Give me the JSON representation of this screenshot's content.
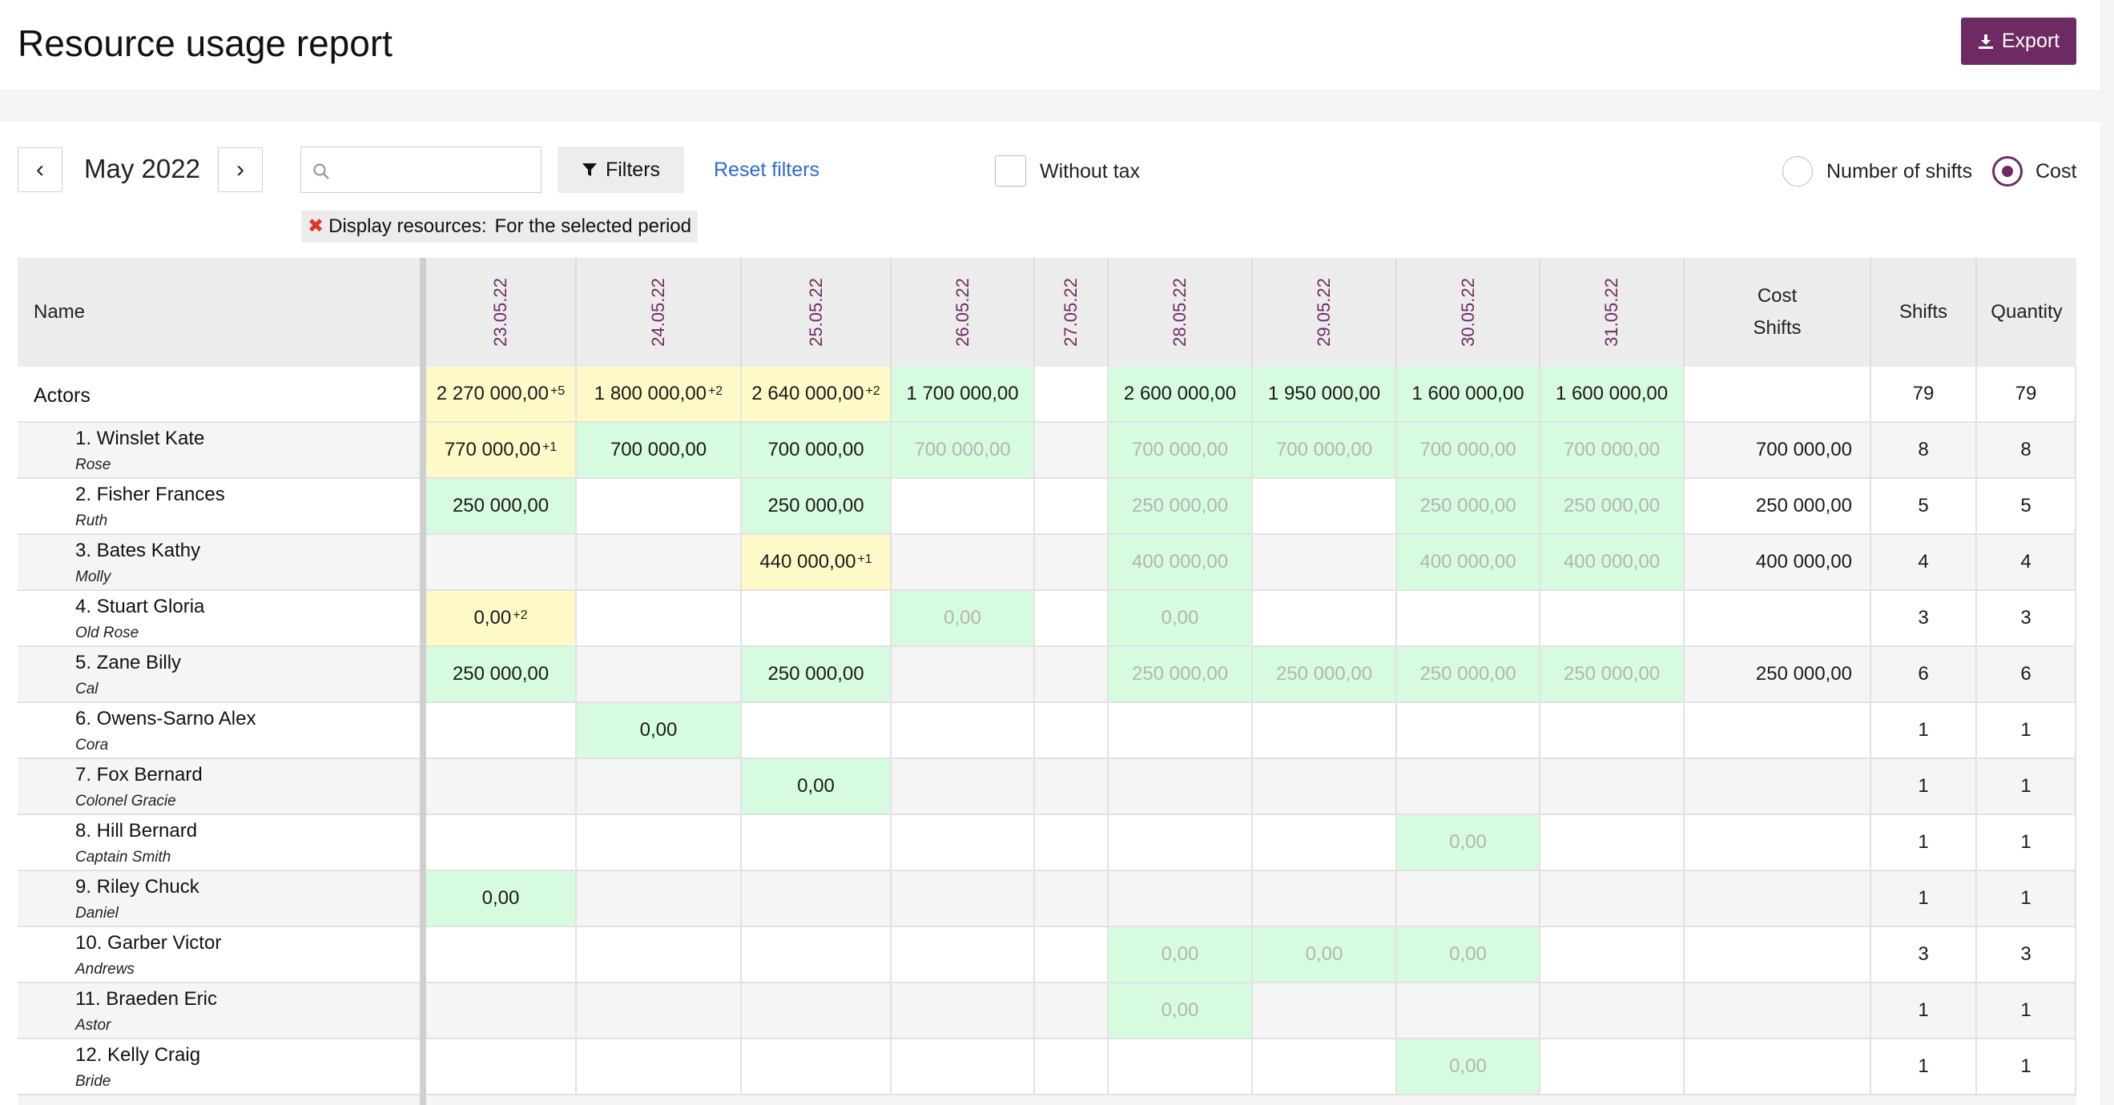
{
  "header": {
    "title": "Resource usage report",
    "export_label": "Export"
  },
  "toolbar": {
    "prev": "‹",
    "next": "›",
    "month": "May 2022",
    "search_placeholder": "",
    "filters_label": "Filters",
    "reset_label": "Reset filters",
    "chip_label": "Display resources:",
    "chip_value": "For the selected period",
    "without_tax": "Without tax",
    "mode_shifts": "Number of shifts",
    "mode_cost": "Cost"
  },
  "table": {
    "name_header": "Name",
    "dates": [
      "23.05.22",
      "24.05.22",
      "25.05.22",
      "26.05.22",
      "27.05.22",
      "28.05.22",
      "29.05.22",
      "30.05.22",
      "31.05.22"
    ],
    "cost_header": "Cost",
    "cost_subheader": "Shifts",
    "shifts_header": "Shifts",
    "quantity_header": "Quantity",
    "group": {
      "name": "Actors",
      "cells": [
        {
          "v": "2 270 000,00",
          "sup": "+5",
          "c": "y"
        },
        {
          "v": "1 800 000,00",
          "sup": "+2",
          "c": "y"
        },
        {
          "v": "2 640 000,00",
          "sup": "+2",
          "c": "y"
        },
        {
          "v": "1 700 000,00",
          "c": "g"
        },
        {
          "v": "",
          "c": ""
        },
        {
          "v": "2 600 000,00",
          "c": "g"
        },
        {
          "v": "1 950 000,00",
          "c": "g"
        },
        {
          "v": "1 600 000,00",
          "c": "g"
        },
        {
          "v": "1 600 000,00",
          "c": "g"
        }
      ],
      "cost": "",
      "shifts": "79",
      "quantity": "79"
    },
    "rows": [
      {
        "name": "1. Winslet Kate",
        "role": "Rose",
        "cells": [
          {
            "v": "770 000,00",
            "sup": "+1",
            "c": "y"
          },
          {
            "v": "700 000,00",
            "c": "g"
          },
          {
            "v": "700 000,00",
            "c": "g"
          },
          {
            "v": "700 000,00",
            "c": "g",
            "d": true
          },
          {
            "v": "",
            "c": ""
          },
          {
            "v": "700 000,00",
            "c": "g",
            "d": true
          },
          {
            "v": "700 000,00",
            "c": "g",
            "d": true
          },
          {
            "v": "700 000,00",
            "c": "g",
            "d": true
          },
          {
            "v": "700 000,00",
            "c": "g",
            "d": true
          }
        ],
        "cost": "700 000,00",
        "shifts": "8",
        "quantity": "8"
      },
      {
        "name": "2. Fisher Frances",
        "role": "Ruth",
        "cells": [
          {
            "v": "250 000,00",
            "c": "g"
          },
          {
            "v": "",
            "c": ""
          },
          {
            "v": "250 000,00",
            "c": "g"
          },
          {
            "v": "",
            "c": ""
          },
          {
            "v": "",
            "c": ""
          },
          {
            "v": "250 000,00",
            "c": "g",
            "d": true
          },
          {
            "v": "",
            "c": ""
          },
          {
            "v": "250 000,00",
            "c": "g",
            "d": true
          },
          {
            "v": "250 000,00",
            "c": "g",
            "d": true
          }
        ],
        "cost": "250 000,00",
        "shifts": "5",
        "quantity": "5"
      },
      {
        "name": "3. Bates Kathy",
        "role": "Molly",
        "cells": [
          {
            "v": "",
            "c": ""
          },
          {
            "v": "",
            "c": ""
          },
          {
            "v": "440 000,00",
            "sup": "+1",
            "c": "y"
          },
          {
            "v": "",
            "c": ""
          },
          {
            "v": "",
            "c": ""
          },
          {
            "v": "400 000,00",
            "c": "g",
            "d": true
          },
          {
            "v": "",
            "c": ""
          },
          {
            "v": "400 000,00",
            "c": "g",
            "d": true
          },
          {
            "v": "400 000,00",
            "c": "g",
            "d": true
          }
        ],
        "cost": "400 000,00",
        "shifts": "4",
        "quantity": "4"
      },
      {
        "name": "4. Stuart Gloria",
        "role": "Old Rose",
        "cells": [
          {
            "v": "0,00",
            "sup": "+2",
            "c": "y"
          },
          {
            "v": "",
            "c": ""
          },
          {
            "v": "",
            "c": ""
          },
          {
            "v": "0,00",
            "c": "g",
            "d": true
          },
          {
            "v": "",
            "c": ""
          },
          {
            "v": "0,00",
            "c": "g",
            "d": true
          },
          {
            "v": "",
            "c": ""
          },
          {
            "v": "",
            "c": ""
          },
          {
            "v": "",
            "c": ""
          }
        ],
        "cost": "",
        "shifts": "3",
        "quantity": "3"
      },
      {
        "name": "5. Zane Billy",
        "role": "Cal",
        "cells": [
          {
            "v": "250 000,00",
            "c": "g"
          },
          {
            "v": "",
            "c": ""
          },
          {
            "v": "250 000,00",
            "c": "g"
          },
          {
            "v": "",
            "c": ""
          },
          {
            "v": "",
            "c": ""
          },
          {
            "v": "250 000,00",
            "c": "g",
            "d": true
          },
          {
            "v": "250 000,00",
            "c": "g",
            "d": true
          },
          {
            "v": "250 000,00",
            "c": "g",
            "d": true
          },
          {
            "v": "250 000,00",
            "c": "g",
            "d": true
          }
        ],
        "cost": "250 000,00",
        "shifts": "6",
        "quantity": "6"
      },
      {
        "name": "6. Owens-Sarno Alex",
        "role": "Cora",
        "cells": [
          {
            "v": "",
            "c": ""
          },
          {
            "v": "0,00",
            "c": "g"
          },
          {
            "v": "",
            "c": ""
          },
          {
            "v": "",
            "c": ""
          },
          {
            "v": "",
            "c": ""
          },
          {
            "v": "",
            "c": ""
          },
          {
            "v": "",
            "c": ""
          },
          {
            "v": "",
            "c": ""
          },
          {
            "v": "",
            "c": ""
          }
        ],
        "cost": "",
        "shifts": "1",
        "quantity": "1"
      },
      {
        "name": "7. Fox Bernard",
        "role": "Colonel Gracie",
        "cells": [
          {
            "v": "",
            "c": ""
          },
          {
            "v": "",
            "c": ""
          },
          {
            "v": "0,00",
            "c": "g"
          },
          {
            "v": "",
            "c": ""
          },
          {
            "v": "",
            "c": ""
          },
          {
            "v": "",
            "c": ""
          },
          {
            "v": "",
            "c": ""
          },
          {
            "v": "",
            "c": ""
          },
          {
            "v": "",
            "c": ""
          }
        ],
        "cost": "",
        "shifts": "1",
        "quantity": "1"
      },
      {
        "name": "8. Hill Bernard",
        "role": "Captain Smith",
        "cells": [
          {
            "v": "",
            "c": ""
          },
          {
            "v": "",
            "c": ""
          },
          {
            "v": "",
            "c": ""
          },
          {
            "v": "",
            "c": ""
          },
          {
            "v": "",
            "c": ""
          },
          {
            "v": "",
            "c": ""
          },
          {
            "v": "",
            "c": ""
          },
          {
            "v": "0,00",
            "c": "g",
            "d": true
          },
          {
            "v": "",
            "c": ""
          }
        ],
        "cost": "",
        "shifts": "1",
        "quantity": "1"
      },
      {
        "name": "9. Riley Chuck",
        "role": "Daniel",
        "cells": [
          {
            "v": "0,00",
            "c": "g"
          },
          {
            "v": "",
            "c": ""
          },
          {
            "v": "",
            "c": ""
          },
          {
            "v": "",
            "c": ""
          },
          {
            "v": "",
            "c": ""
          },
          {
            "v": "",
            "c": ""
          },
          {
            "v": "",
            "c": ""
          },
          {
            "v": "",
            "c": ""
          },
          {
            "v": "",
            "c": ""
          }
        ],
        "cost": "",
        "shifts": "1",
        "quantity": "1"
      },
      {
        "name": "10. Garber Victor",
        "role": "Andrews",
        "cells": [
          {
            "v": "",
            "c": ""
          },
          {
            "v": "",
            "c": ""
          },
          {
            "v": "",
            "c": ""
          },
          {
            "v": "",
            "c": ""
          },
          {
            "v": "",
            "c": ""
          },
          {
            "v": "0,00",
            "c": "g",
            "d": true
          },
          {
            "v": "0,00",
            "c": "g",
            "d": true
          },
          {
            "v": "0,00",
            "c": "g",
            "d": true
          },
          {
            "v": "",
            "c": ""
          }
        ],
        "cost": "",
        "shifts": "3",
        "quantity": "3"
      },
      {
        "name": "11. Braeden Eric",
        "role": "Astor",
        "cells": [
          {
            "v": "",
            "c": ""
          },
          {
            "v": "",
            "c": ""
          },
          {
            "v": "",
            "c": ""
          },
          {
            "v": "",
            "c": ""
          },
          {
            "v": "",
            "c": ""
          },
          {
            "v": "0,00",
            "c": "g",
            "d": true
          },
          {
            "v": "",
            "c": ""
          },
          {
            "v": "",
            "c": ""
          },
          {
            "v": "",
            "c": ""
          }
        ],
        "cost": "",
        "shifts": "1",
        "quantity": "1"
      },
      {
        "name": "12. Kelly Craig",
        "role": "Bride",
        "cells": [
          {
            "v": "",
            "c": ""
          },
          {
            "v": "",
            "c": ""
          },
          {
            "v": "",
            "c": ""
          },
          {
            "v": "",
            "c": ""
          },
          {
            "v": "",
            "c": ""
          },
          {
            "v": "",
            "c": ""
          },
          {
            "v": "",
            "c": ""
          },
          {
            "v": "0,00",
            "c": "g",
            "d": true
          },
          {
            "v": "",
            "c": ""
          }
        ],
        "cost": "",
        "shifts": "1",
        "quantity": "1"
      }
    ]
  },
  "colors": {
    "accent": "#6e2a63",
    "link": "#2c6bd1",
    "yellow_cell": "#fefac8",
    "green_cell": "#d6fbdf",
    "dim_text": "#b4b4b4"
  }
}
